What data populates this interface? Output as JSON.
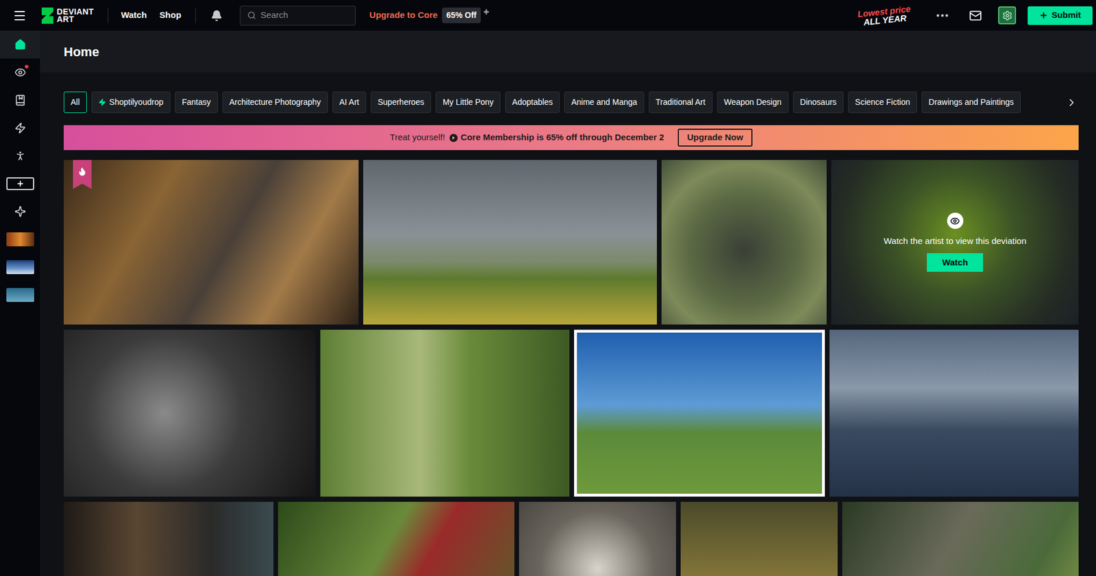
{
  "topbar": {
    "logo": [
      "DEVIANT",
      "ART"
    ],
    "nav": [
      {
        "label": "Watch"
      },
      {
        "label": "Shop"
      }
    ],
    "search": {
      "placeholder": "Search"
    },
    "upgrade": "Upgrade to Core",
    "discount": "65% Off",
    "promo": {
      "line1": "Lowest price",
      "line2": "ALL YEAR"
    },
    "more": "•••",
    "submit": "Submit"
  },
  "sidebar": {
    "items": [
      {
        "kind": "icon",
        "selected": true,
        "notify": false
      },
      {
        "kind": "icon",
        "selected": false,
        "notify": true
      },
      {
        "kind": "icon",
        "selected": false,
        "notify": false
      },
      {
        "kind": "icon",
        "selected": false,
        "notify": false
      },
      {
        "kind": "icon",
        "selected": false,
        "notify": false
      },
      {
        "kind": "button",
        "selected": false,
        "notify": false
      },
      {
        "kind": "icon",
        "selected": false,
        "notify": false
      },
      {
        "kind": "thumb",
        "selected": false,
        "notify": false
      },
      {
        "kind": "thumb",
        "selected": false,
        "notify": false
      },
      {
        "kind": "thumb",
        "selected": false,
        "notify": false
      }
    ]
  },
  "page": {
    "title": "Home"
  },
  "categories": [
    {
      "label": "All",
      "selected": true,
      "kind": "plain"
    },
    {
      "label": "Shoptilyoudrop",
      "selected": false,
      "kind": "featured"
    },
    {
      "label": "Fantasy",
      "selected": false,
      "kind": "plain"
    },
    {
      "label": "Architecture Photography",
      "selected": false,
      "kind": "plain"
    },
    {
      "label": "AI Art",
      "selected": false,
      "kind": "plain"
    },
    {
      "label": "Superheroes",
      "selected": false,
      "kind": "plain"
    },
    {
      "label": "My Little Pony",
      "selected": false,
      "kind": "plain"
    },
    {
      "label": "Adoptables",
      "selected": false,
      "kind": "plain"
    },
    {
      "label": "Anime and Manga",
      "selected": false,
      "kind": "plain"
    },
    {
      "label": "Traditional Art",
      "selected": false,
      "kind": "plain"
    },
    {
      "label": "Weapon Design",
      "selected": false,
      "kind": "plain"
    },
    {
      "label": "Dinosaurs",
      "selected": false,
      "kind": "plain"
    },
    {
      "label": "Science Fiction",
      "selected": false,
      "kind": "plain"
    },
    {
      "label": "Drawings and Paintings",
      "selected": false,
      "kind": "plain"
    }
  ],
  "banner": {
    "lead": "Treat yourself!",
    "message": "Core Membership is 65% off through December 2",
    "button": "Upgrade Now"
  },
  "gallery": {
    "rows": [
      [
        {
          "kind": "photo",
          "hot": true
        },
        {
          "kind": "photo",
          "hot": false
        },
        {
          "kind": "photo",
          "hot": false
        },
        {
          "kind": "locked",
          "hot": false,
          "message": "Watch the artist to view this deviation",
          "button": "Watch"
        }
      ],
      [
        {
          "kind": "photo",
          "hot": false
        },
        {
          "kind": "photo",
          "hot": false
        },
        {
          "kind": "photo",
          "hot": false
        },
        {
          "kind": "photo",
          "hot": false
        }
      ],
      [
        {
          "kind": "photo",
          "hot": false
        },
        {
          "kind": "photo",
          "hot": false
        },
        {
          "kind": "photo",
          "hot": false
        },
        {
          "kind": "photo",
          "hot": false
        },
        {
          "kind": "photo",
          "hot": false
        }
      ]
    ]
  }
}
